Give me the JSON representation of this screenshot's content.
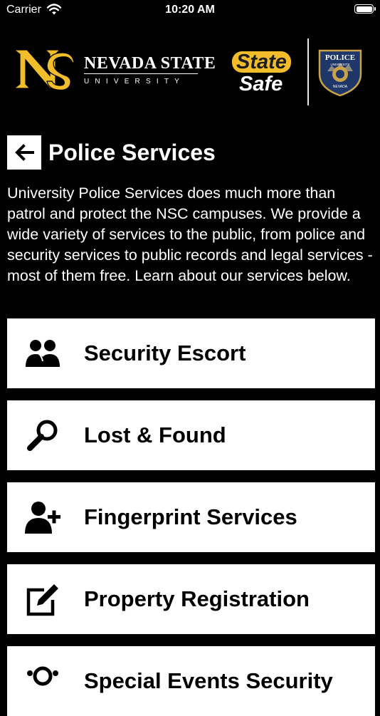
{
  "status_bar": {
    "carrier": "Carrier",
    "time": "10:20 AM"
  },
  "header": {
    "university_name": "NEVADA STATE",
    "university_subtitle": "UNIVERSITY",
    "app_name_line1": "State",
    "app_name_line2": "Safe",
    "badge_text_top": "POLICE",
    "badge_text_mid": "UNIVERSITY",
    "badge_text_bottom": "NEVADA"
  },
  "page": {
    "title": "Police Services",
    "intro": "University Police Services does much more than patrol and protect the NSC campuses. We provide a wide variety of services to the public, from police and security services to public records and legal services - most of them free. Learn about our services below."
  },
  "services": [
    {
      "label": "Security Escort",
      "icon": "users-icon"
    },
    {
      "label": "Lost & Found",
      "icon": "magnifier-icon"
    },
    {
      "label": "Fingerprint Services",
      "icon": "user-plus-icon"
    },
    {
      "label": "Property Registration",
      "icon": "edit-icon"
    },
    {
      "label": "Special Events Security",
      "icon": "event-icon"
    }
  ],
  "colors": {
    "background": "#000000",
    "card": "#ffffff",
    "gold": "#f2bd2b",
    "badge_blue": "#1f3768"
  }
}
